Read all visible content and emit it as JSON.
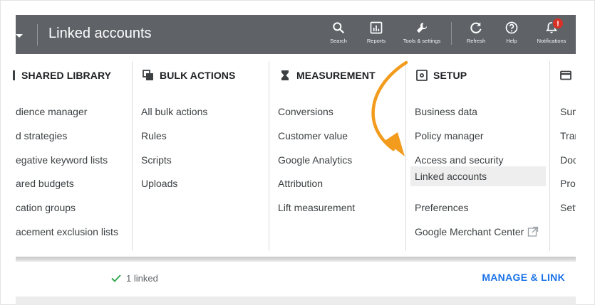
{
  "header": {
    "title": "Linked accounts",
    "tools": [
      {
        "label": "Search",
        "icon": "search-icon"
      },
      {
        "label": "Reports",
        "icon": "reports-icon"
      },
      {
        "label": "Tools & settings",
        "icon": "wrench-icon"
      },
      {
        "label": "Refresh",
        "icon": "refresh-icon"
      },
      {
        "label": "Help",
        "icon": "help-icon"
      },
      {
        "label": "Notifications",
        "icon": "bell-icon",
        "badge": "!"
      }
    ]
  },
  "menu": {
    "columns": [
      {
        "heading": "SHARED LIBRARY",
        "icon": "library-icon",
        "items": [
          "dience manager",
          "d strategies",
          "egative keyword lists",
          "ared budgets",
          "cation groups",
          "acement exclusion lists"
        ]
      },
      {
        "heading": "BULK ACTIONS",
        "icon": "bulk-actions-icon",
        "items": [
          "All bulk actions",
          "Rules",
          "Scripts",
          "Uploads"
        ]
      },
      {
        "heading": "MEASUREMENT",
        "icon": "hourglass-icon",
        "items": [
          "Conversions",
          "Customer value",
          "Google Analytics",
          "Attribution",
          "Lift measurement"
        ]
      },
      {
        "heading": "SETUP",
        "icon": "setup-icon",
        "items": [
          "Business data",
          "Policy manager",
          "Access and security",
          "Linked accounts",
          "Preferences",
          "Google Merchant Center"
        ],
        "active_item": "Linked accounts",
        "external_link_icon": "external-link-icon"
      },
      {
        "heading": "",
        "icon": "billing-card-icon",
        "items": [
          "Sum",
          "Tran",
          "Doc",
          "Pron",
          "Sett"
        ]
      }
    ]
  },
  "status": {
    "linked_text": "1 linked",
    "action_label": "MANAGE & LINK"
  },
  "colors": {
    "header_bg": "#5f6368",
    "accent_link": "#1a73e8",
    "annotation_arrow": "#f29b1d",
    "badge": "#d93025",
    "check": "#34a853"
  }
}
